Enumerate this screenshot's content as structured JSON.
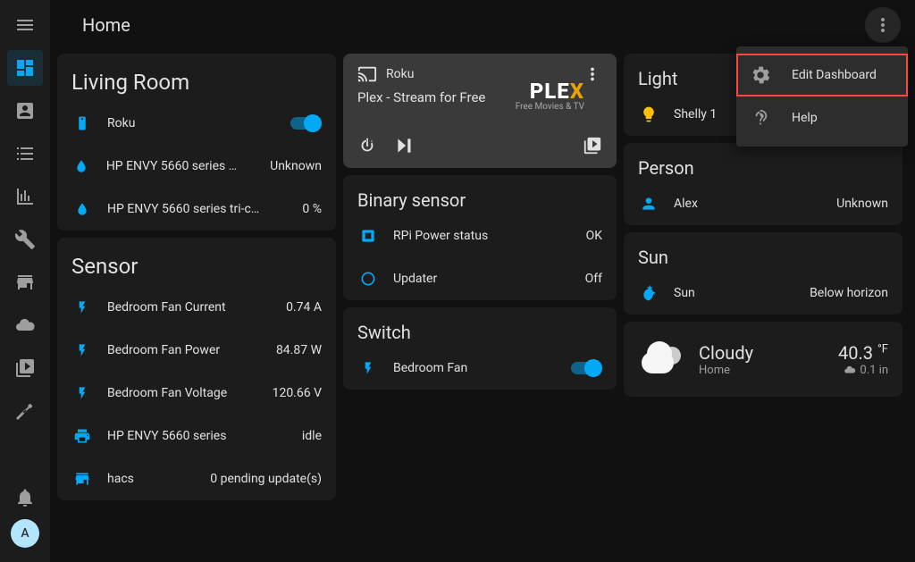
{
  "header": {
    "title": "Home"
  },
  "avatar": {
    "initial": "A"
  },
  "menu": {
    "items": [
      {
        "label": "Edit Dashboard",
        "icon": "gear"
      },
      {
        "label": "Help",
        "icon": "help"
      }
    ]
  },
  "living_room": {
    "title": "Living Room",
    "entities": [
      {
        "icon": "remote",
        "label": "Roku",
        "control": "toggle_on"
      },
      {
        "icon": "water",
        "label": "HP ENVY 5660 series bl...",
        "value": "Unknown"
      },
      {
        "icon": "water",
        "label": "HP ENVY 5660 series tri-colo...",
        "value": "0 %"
      }
    ]
  },
  "sensor": {
    "title": "Sensor",
    "entities": [
      {
        "icon": "flash",
        "label": "Bedroom Fan Current",
        "value": "0.74 A"
      },
      {
        "icon": "flash",
        "label": "Bedroom Fan Power",
        "value": "84.87 W"
      },
      {
        "icon": "flash",
        "label": "Bedroom Fan Voltage",
        "value": "120.66 V"
      },
      {
        "icon": "printer",
        "label": "HP ENVY 5660 series",
        "value": "idle"
      },
      {
        "icon": "store",
        "label": "hacs",
        "value": "0 pending update(s)"
      }
    ]
  },
  "media": {
    "device": "Roku",
    "subtitle": "Plex - Stream for Free",
    "brand": "PLEX",
    "tagline": "Free Movies & TV"
  },
  "binary_sensor": {
    "title": "Binary sensor",
    "entities": [
      {
        "icon": "chip",
        "label": "RPi Power status",
        "value": "OK"
      },
      {
        "icon": "circle",
        "label": "Updater",
        "value": "Off"
      }
    ]
  },
  "switch": {
    "title": "Switch",
    "entities": [
      {
        "icon": "flash",
        "label": "Bedroom Fan",
        "control": "toggle_on"
      }
    ]
  },
  "light": {
    "title": "Light",
    "entities": [
      {
        "icon": "bulb",
        "label": "Shelly 1",
        "value": ""
      }
    ]
  },
  "person": {
    "title": "Person",
    "entities": [
      {
        "icon": "person",
        "label": "Alex",
        "value": "Unknown"
      }
    ]
  },
  "sun": {
    "title": "Sun",
    "entities": [
      {
        "icon": "moon",
        "label": "Sun",
        "value": "Below horizon"
      }
    ]
  },
  "weather": {
    "condition": "Cloudy",
    "location": "Home",
    "temp": "40.3",
    "temp_unit": "°F",
    "precip": "0.1 in"
  }
}
